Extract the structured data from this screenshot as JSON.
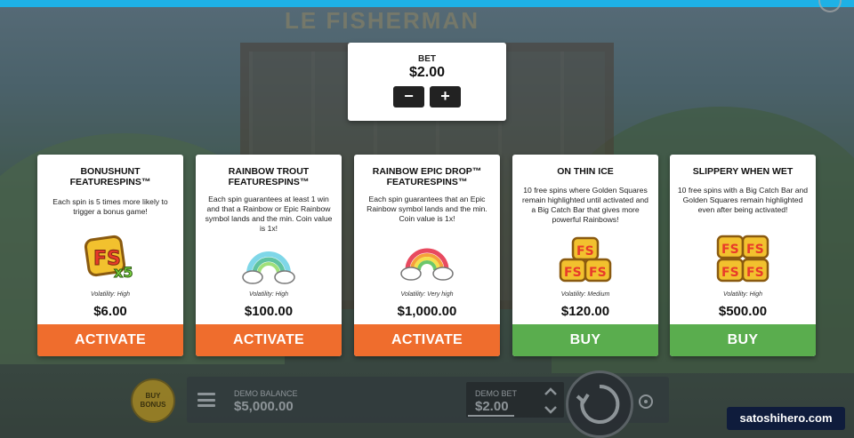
{
  "game": {
    "logo_text": "LE FISHERMAN"
  },
  "bet_panel": {
    "label": "BET",
    "value": "$2.00",
    "decrease_label": "−",
    "increase_label": "+"
  },
  "cards": [
    {
      "title_line1": "BONUSHUNT",
      "title_line2": "FEATURESPINS™",
      "description": "Each spin is 5 times more likely to trigger a bonus game!",
      "icon": "fs-x5-badge-icon",
      "volatility": "Volatility: High",
      "price": "$6.00",
      "action": "ACTIVATE",
      "action_color": "#ef6d2d"
    },
    {
      "title_line1": "RAINBOW TROUT",
      "title_line2": "FEATURESPINS™",
      "description": "Each spin guarantees at least 1 win and that a Rainbow or Epic Rainbow symbol lands and the min. Coin value is 1x!",
      "icon": "rainbow-cloud-icon",
      "volatility": "Volatility: High",
      "price": "$100.00",
      "action": "ACTIVATE",
      "action_color": "#ef6d2d"
    },
    {
      "title_line1": "RAINBOW EPIC DROP™",
      "title_line2": "FEATURESPINS™",
      "description": "Each spin guarantees that an Epic Rainbow symbol lands and the min. Coin value is 1x!",
      "icon": "epic-rainbow-cloud-icon",
      "volatility": "Volatility: Very high",
      "price": "$1,000.00",
      "action": "ACTIVATE",
      "action_color": "#ef6d2d"
    },
    {
      "title_line1": "ON THIN ICE",
      "title_line2": "",
      "description": "10 free spins where Golden Squares remain highlighted until activated and a Big Catch Bar that gives more powerful Rainbows!",
      "icon": "fs-gold-stack-icon",
      "volatility": "Volatility: Medium",
      "price": "$120.00",
      "action": "BUY",
      "action_color": "#5aad4e"
    },
    {
      "title_line1": "SLIPPERY WHEN WET",
      "title_line2": "",
      "description": "10 free spins with a Big Catch Bar and Golden Squares remain highlighted even after being activated!",
      "icon": "fs-gold-grid-icon",
      "volatility": "Volatility: High",
      "price": "$500.00",
      "action": "BUY",
      "action_color": "#5aad4e"
    }
  ],
  "bottom_bar": {
    "buy_bonus_line1": "BUY",
    "buy_bonus_line2": "BONUS",
    "balance_label": "DEMO BALANCE",
    "balance_value": "$5,000.00",
    "demo_bet_label": "DEMO BET",
    "demo_bet_value": "$2.00"
  },
  "watermark": "satoshihero.com",
  "colors": {
    "top_bar": "#1eb1e6",
    "activate": "#ef6d2d",
    "buy": "#5aad4e"
  }
}
